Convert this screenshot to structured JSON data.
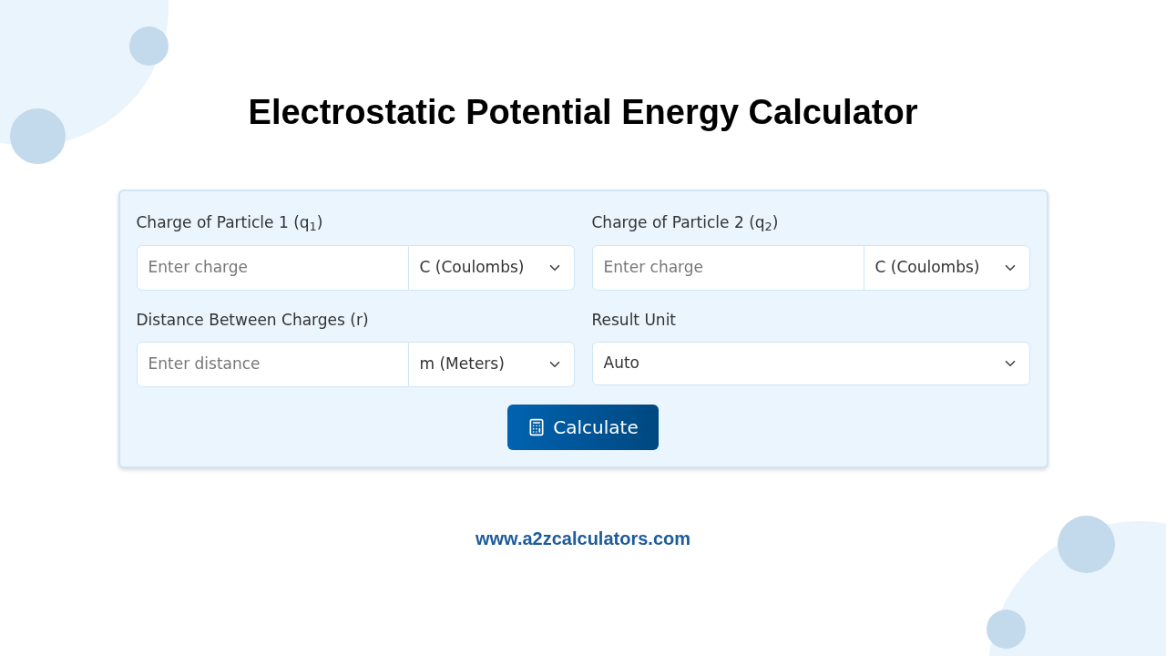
{
  "title": "Electrostatic Potential Energy Calculator",
  "fields": [
    {
      "kind": "input_select",
      "label": "Charge of Particle 1 (q$_{1}$)",
      "placeholder": "Enter charge",
      "unit": "C (Coulombs)"
    },
    {
      "kind": "input_select",
      "label": "Charge of Particle 2 (q$_{2}$)",
      "placeholder": "Enter charge",
      "unit": "C (Coulombs)"
    },
    {
      "kind": "input_select",
      "label": "Distance Between Charges (r)",
      "placeholder": "Enter distance",
      "unit": "m (Meters)"
    },
    {
      "kind": "select",
      "label": "Result Unit",
      "value": "Auto"
    }
  ],
  "button": "Calculate",
  "footer": "www.a2zcalculators.com"
}
